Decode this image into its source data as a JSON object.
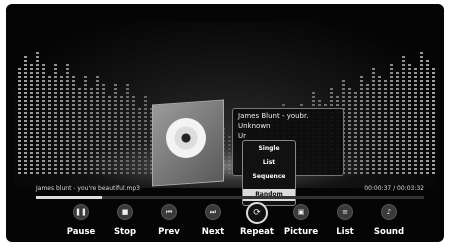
{
  "now_playing": {
    "info_title": "James Blunt - youbr.",
    "info_album": "Unknown",
    "info_extra": "Ur",
    "song_title": "James blunt - you're beautiful.mp3",
    "time": "00:00:37 / 00:03:32",
    "progress": 0.17
  },
  "repeat_menu": {
    "items": [
      {
        "label": "Single",
        "selected": false
      },
      {
        "label": "List",
        "selected": false
      },
      {
        "label": "Sequence",
        "selected": false
      },
      {
        "label": "Random",
        "selected": true
      }
    ]
  },
  "controls": [
    {
      "label": "Pause",
      "icon": "pause-icon",
      "glyph": "❚❚"
    },
    {
      "label": "Stop",
      "icon": "stop-icon",
      "glyph": "■"
    },
    {
      "label": "Prev",
      "icon": "prev-icon",
      "glyph": "⏮"
    },
    {
      "label": "Next",
      "icon": "next-icon",
      "glyph": "⏭"
    },
    {
      "label": "Repeat",
      "icon": "repeat-icon",
      "glyph": "⟳",
      "active": true
    },
    {
      "label": "Picture",
      "icon": "picture-icon",
      "glyph": "▣"
    },
    {
      "label": "List",
      "icon": "list-icon",
      "glyph": "≡"
    },
    {
      "label": "Sound",
      "icon": "sound-icon",
      "glyph": "♪"
    }
  ]
}
